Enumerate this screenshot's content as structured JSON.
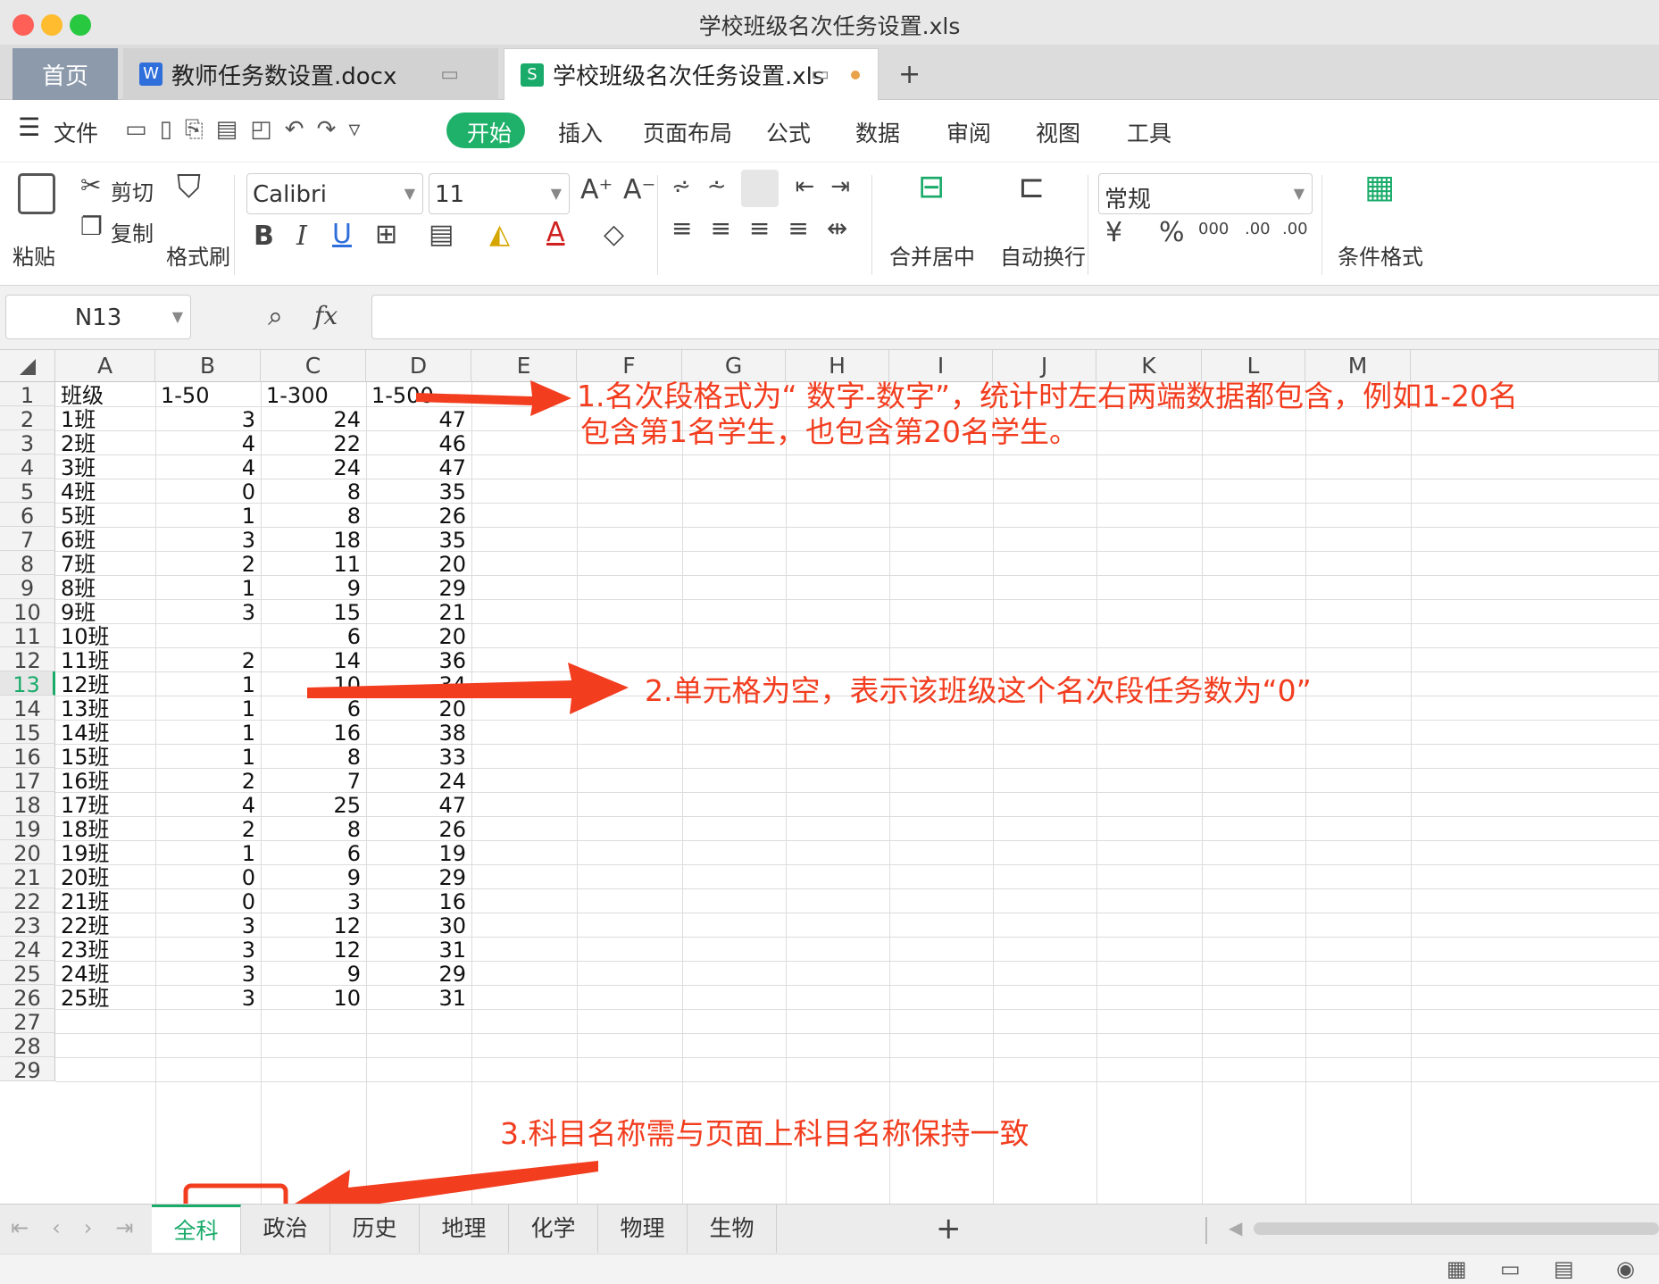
{
  "window": {
    "title": "学校班级名次任务设置.xls"
  },
  "tabs": [
    {
      "label": "首页"
    },
    {
      "label": "教师任务数设置.docx"
    },
    {
      "label": "学校班级名次任务设置.xls"
    }
  ],
  "menu": {
    "file": "文件",
    "items": [
      "开始",
      "插入",
      "页面布局",
      "公式",
      "数据",
      "审阅",
      "视图",
      "工具"
    ]
  },
  "toolbar": {
    "paste": "粘贴",
    "cut": "剪切",
    "copy": "复制",
    "format_painter": "格式刷",
    "font": "Calibri",
    "size": "11",
    "merge": "合并居中",
    "wrap": "自动换行",
    "number_format": "常规",
    "conditional": "条件格式",
    "percent": "%",
    "thousands": "000",
    "inc_decimal": ".00",
    "dec_decimal": ".00"
  },
  "formula_bar": {
    "name_box": "N13",
    "fx": "fx",
    "value": ""
  },
  "grid": {
    "columns": [
      "A",
      "B",
      "C",
      "D",
      "E",
      "F",
      "G",
      "H",
      "I",
      "J",
      "K",
      "L",
      "M"
    ],
    "row_numbers": [
      "1",
      "2",
      "3",
      "4",
      "5",
      "6",
      "7",
      "8",
      "9",
      "10",
      "11",
      "12",
      "13",
      "14",
      "15",
      "16",
      "17",
      "18",
      "19",
      "20",
      "21",
      "22",
      "23",
      "24",
      "25",
      "26",
      "27",
      "28",
      "29"
    ],
    "active_row": "13",
    "header_row": [
      "班级",
      "1-50",
      "1-300",
      "1-500"
    ],
    "rows": [
      [
        "1班",
        "3",
        "24",
        "47"
      ],
      [
        "2班",
        "4",
        "22",
        "46"
      ],
      [
        "3班",
        "4",
        "24",
        "47"
      ],
      [
        "4班",
        "0",
        "8",
        "35"
      ],
      [
        "5班",
        "1",
        "8",
        "26"
      ],
      [
        "6班",
        "3",
        "18",
        "35"
      ],
      [
        "7班",
        "2",
        "11",
        "20"
      ],
      [
        "8班",
        "1",
        "9",
        "29"
      ],
      [
        "9班",
        "3",
        "15",
        "21"
      ],
      [
        "10班",
        "",
        "6",
        "20"
      ],
      [
        "11班",
        "2",
        "14",
        "36"
      ],
      [
        "12班",
        "1",
        "10",
        "34"
      ],
      [
        "13班",
        "1",
        "6",
        "20"
      ],
      [
        "14班",
        "1",
        "16",
        "38"
      ],
      [
        "15班",
        "1",
        "8",
        "33"
      ],
      [
        "16班",
        "2",
        "7",
        "24"
      ],
      [
        "17班",
        "4",
        "25",
        "47"
      ],
      [
        "18班",
        "2",
        "8",
        "26"
      ],
      [
        "19班",
        "1",
        "6",
        "19"
      ],
      [
        "20班",
        "0",
        "9",
        "29"
      ],
      [
        "21班",
        "0",
        "3",
        "16"
      ],
      [
        "22班",
        "3",
        "12",
        "30"
      ],
      [
        "23班",
        "3",
        "12",
        "31"
      ],
      [
        "24班",
        "3",
        "9",
        "29"
      ],
      [
        "25班",
        "3",
        "10",
        "31"
      ]
    ]
  },
  "sheets": [
    {
      "label": "全科",
      "active": true
    },
    {
      "label": "政治"
    },
    {
      "label": "历史"
    },
    {
      "label": "地理"
    },
    {
      "label": "化学"
    },
    {
      "label": "物理"
    },
    {
      "label": "生物"
    }
  ],
  "annotations": {
    "note1_line1": "1.名次段格式为“ 数字-数字”，统计时左右两端数据都包含，例如1-20名",
    "note1_line2": "包含第1名学生，也包含第20名学生。",
    "note2": "2.单元格为空，表示该班级这个名次段任务数为“0”",
    "note3": "3.科目名称需与页面上科目名称保持一致",
    "color": "#f23d1f"
  },
  "colors": {
    "accent_green": "#1aab6a",
    "start_button": "#1fb16a",
    "annotation_red": "#f23d1f"
  }
}
